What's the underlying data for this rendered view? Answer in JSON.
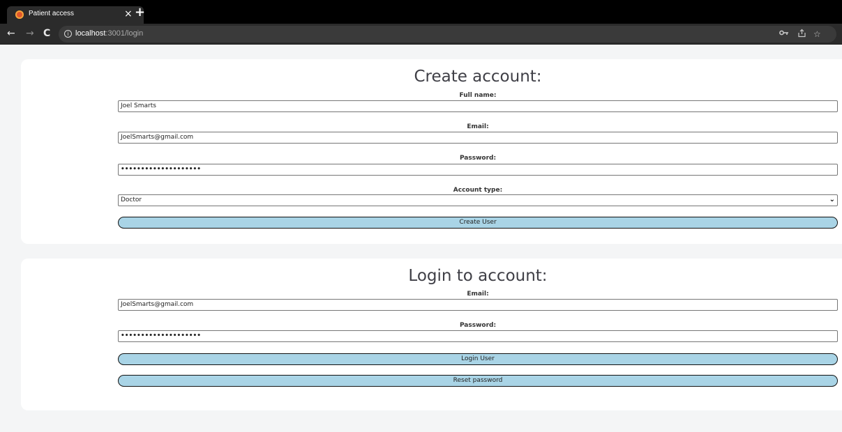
{
  "browser": {
    "tab_title": "Patient access",
    "tab_close": "×",
    "new_tab": "+",
    "url_host": "localhost",
    "url_path": ":3001/login",
    "icons": {
      "back": "arrow-left-icon",
      "forward": "arrow-right-icon",
      "reload": "reload-icon",
      "info": "info-icon",
      "key": "key-icon",
      "share": "share-icon",
      "star": "star-icon"
    }
  },
  "create_account": {
    "heading": "Create account:",
    "full_name_label": "Full name:",
    "full_name_value": "Joel Smarts",
    "email_label": "Email:",
    "email_value": "JoelSmarts@gmail.com",
    "password_label": "Password:",
    "password_value": "••••••••••••••••••••",
    "account_type_label": "Account type:",
    "account_type_value": "Doctor",
    "submit_label": "Create User"
  },
  "login": {
    "heading": "Login to account:",
    "email_label": "Email:",
    "email_value": "JoelSmarts@gmail.com",
    "password_label": "Password:",
    "password_value": "••••••••••••••••••••",
    "login_label": "Login User",
    "reset_label": "Reset password"
  },
  "colors": {
    "page_background": "#f4f5f6",
    "card_background": "#ffffff",
    "button_fill": "#a9d4e6",
    "button_border": "#111111",
    "heading_text": "#3f3f46",
    "chrome_dark": "#000000",
    "toolbar": "#2b2b2b"
  }
}
